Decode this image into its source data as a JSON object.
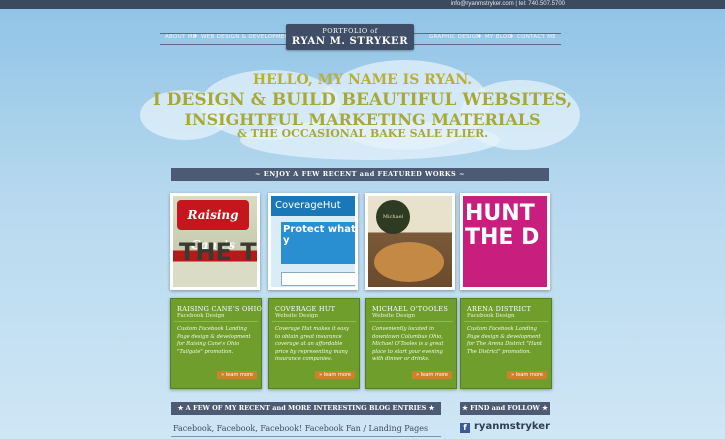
{
  "topbar": {
    "contact": "info@ryanmstryker.com | tel: 740.507.5700"
  },
  "nav": {
    "left": [
      "About Me",
      "Web Design & Development"
    ],
    "right": [
      "Graphic Design",
      "My Blog",
      "Contact Me"
    ]
  },
  "logo": {
    "line1": "PORTFOLIO of",
    "line2": "RYAN M. STRYKER"
  },
  "hero": {
    "line1": "HELLO, MY NAME IS RYAN.",
    "line2": "I DESIGN & BUILD BEAUTIFUL WEBSITES,",
    "line3": "INSIGHTFUL MARKETING MATERIALS",
    "line4": "& THE OCCASIONAL BAKE SALE FLIER."
  },
  "works_banner": "~ ENJOY A FEW RECENT and FEATURED WORKS ~",
  "works": [
    {
      "title": "RAISING CANE'S OHIO",
      "subtitle": "Facebook Design",
      "description": "Custom Facebook Landing Page design & development for Raising Cane's Ohio \"Tailgate\" promotion.",
      "more": "» learn more",
      "thumb_text": "Raising Cane's"
    },
    {
      "title": "COVERAGE HUT",
      "subtitle": "Website Design",
      "description": "Coverage Hut makes it easy to obtain great insurance coverage at an affordable price by representing many insurance companies.",
      "more": "» learn more",
      "thumb_text": "CoverageHut"
    },
    {
      "title": "MICHAEL O'TOOLES",
      "subtitle": "Website Design",
      "description": "Conveniently located in downtown Columbus Ohio, Michael O'Tooles is a great place to start your evening with dinner or drinks.",
      "more": "» learn more",
      "thumb_text": "Michael O'Tooles"
    },
    {
      "title": "ARENA DISTRICT",
      "subtitle": "Facebook Design",
      "description": "Custom Facebook Landing Page design & development for The Arena District \"Hunt The District\" promotion.",
      "more": "» learn more",
      "thumb_text": "HUNT THE D"
    }
  ],
  "blog_banner": "★ A FEW OF MY RECENT and MORE INTERESTING BLOG ENTRIES ★",
  "blog_entry": "Facebook, Facebook, Facebook! Facebook Fan / Landing Pages",
  "find_banner": "★ FIND and FOLLOW ★",
  "social": {
    "icon": "facebook-icon",
    "name": "ryanmstryker"
  },
  "colors": {
    "banner": "#4c5b73",
    "card": "#6f9e2d",
    "accent_gold": "#a8a83a",
    "button": "#c9832b"
  }
}
